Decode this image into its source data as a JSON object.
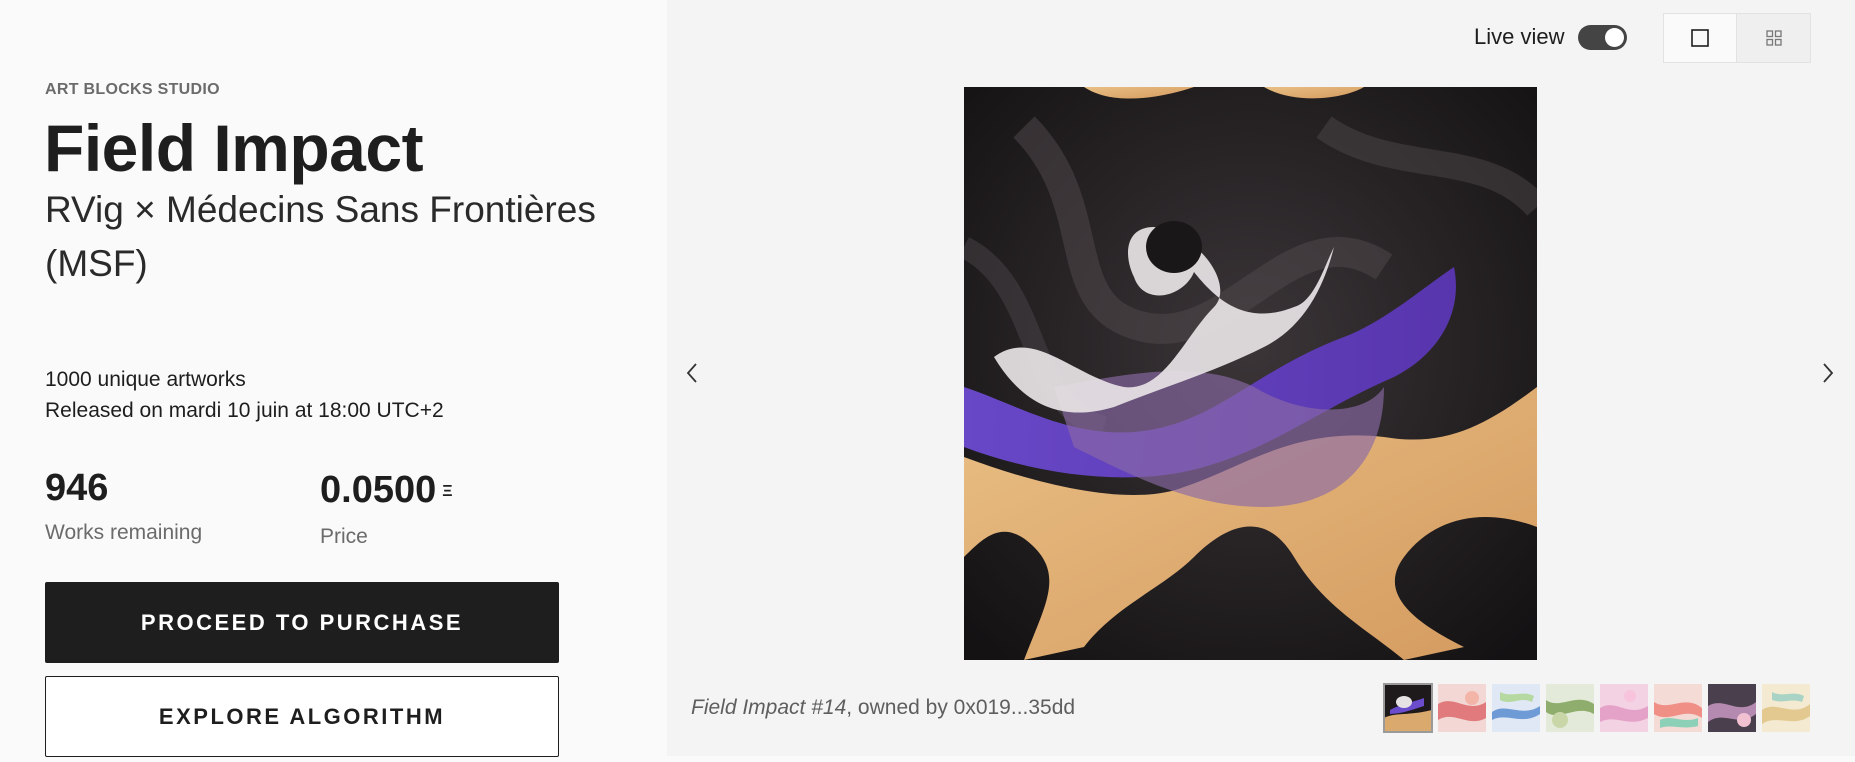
{
  "project": {
    "studio": "ART BLOCKS STUDIO",
    "title": "Field Impact",
    "subtitle": "RVig × Médecins Sans Frontières (MSF)",
    "artworks_count": "1000 unique artworks",
    "release": "Released on mardi 10 juin at 18:00 UTC+2"
  },
  "stats": {
    "remaining_value": "946",
    "remaining_label": "Works remaining",
    "price_value": "0.0500",
    "price_currency": "Ξ",
    "price_label": "Price"
  },
  "actions": {
    "purchase": "PROCEED TO PURCHASE",
    "explore": "EXPLORE ALGORITHM"
  },
  "viewer": {
    "live_view_label": "Live view",
    "live_view_on": true,
    "caption_title": "Field Impact #14",
    "caption_owner": ", owned by 0x019...35dd"
  },
  "icons": {
    "prev": "chevron-left-icon",
    "next": "chevron-right-icon",
    "single": "square-icon",
    "grid": "grid-icon"
  },
  "colors": {
    "primary": "#1e1e1e",
    "panel": "#f4f4f4",
    "muted": "#6b6b6b"
  }
}
